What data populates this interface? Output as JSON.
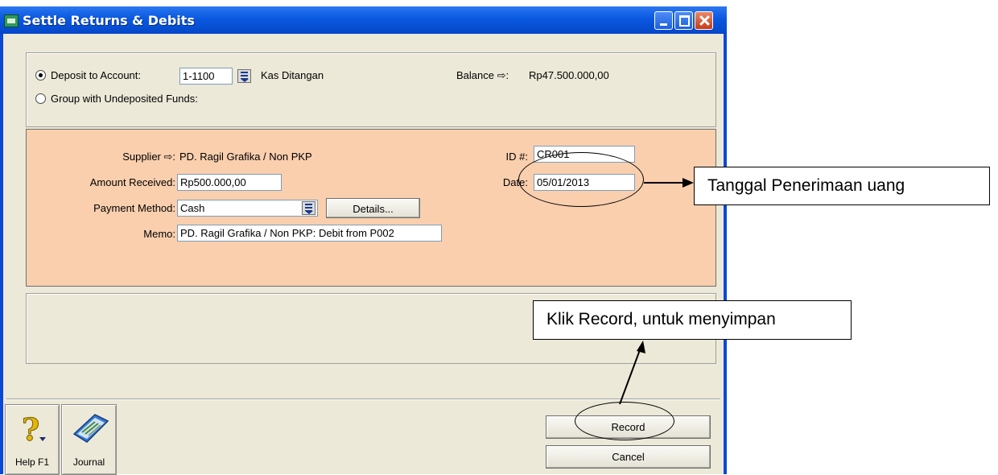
{
  "window": {
    "title": "Settle Returns & Debits"
  },
  "deposit": {
    "deposit_radio_label": "Deposit to Account:",
    "account_number": "1-1100",
    "account_name": "Kas Ditangan",
    "balance_label": "Balance ⇨:",
    "balance_value": "Rp47.500.000,00",
    "undeposited_radio_label": "Group with Undeposited Funds:"
  },
  "supplier_panel": {
    "supplier_label": "Supplier ⇨:",
    "supplier_value": "PD. Ragil Grafika / Non PKP",
    "id_label": "ID #:",
    "id_value": "CR001",
    "amount_label": "Amount Received:",
    "amount_value": "Rp500.000,00",
    "date_label": "Date:",
    "date_value": "05/01/2013",
    "payment_method_label": "Payment Method:",
    "payment_method_value": "Cash",
    "details_button": "Details...",
    "memo_label": "Memo:",
    "memo_value": "PD. Ragil Grafika / Non PKP:  Debit from P002"
  },
  "toolbar": {
    "help_label": "Help F1",
    "journal_label": "Journal",
    "record_label": "Record",
    "cancel_label": "Cancel"
  },
  "annotations": {
    "date_callout": "Tanggal Penerimaan uang",
    "record_callout": "Klik Record, untuk menyimpan"
  }
}
